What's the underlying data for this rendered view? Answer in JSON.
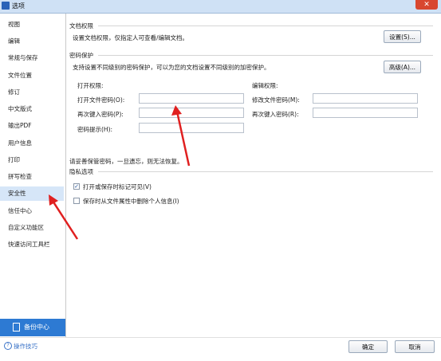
{
  "window": {
    "title": "选项",
    "close_symbol": "✕"
  },
  "sidebar": {
    "items": [
      {
        "label": "视图"
      },
      {
        "label": "编辑"
      },
      {
        "label": "常规与保存"
      },
      {
        "label": "文件位置"
      },
      {
        "label": "修订"
      },
      {
        "label": "中文版式"
      },
      {
        "label": "输出PDF"
      },
      {
        "label": "用户信息"
      },
      {
        "label": "打印"
      },
      {
        "label": "拼写检查"
      },
      {
        "label": "安全性",
        "active": true
      },
      {
        "label": "信任中心"
      },
      {
        "label": "自定义功能区"
      },
      {
        "label": "快速访问工具栏"
      }
    ],
    "backup_label": "备份中心"
  },
  "doc_permission": {
    "title": "文档权限",
    "desc": "设置文档权限，仅指定人可查看/编辑文档。",
    "button": "设置(S)..."
  },
  "password": {
    "title": "密码保护",
    "desc": "支持设置不同级别的密码保护，可以为您的文档设置不同级别的加密保护。",
    "advanced_button": "高级(A)...",
    "open_group": "打开权限:",
    "open_password_label": "打开文件密码(O):",
    "open_confirm_label": "再次键入密码(P):",
    "hint_label": "密码提示(H):",
    "edit_group": "编辑权限:",
    "edit_password_label": "修改文件密码(M):",
    "edit_confirm_label": "再次键入密码(R):",
    "warning": "请妥善保管密码，一旦遗忘，则无法恢复。",
    "open_password_value": "",
    "open_confirm_value": "",
    "hint_value": "",
    "edit_password_value": "",
    "edit_confirm_value": ""
  },
  "privacy": {
    "title": "隐私选项",
    "option1": "打开或保存时标记可见(V)",
    "option1_checked": true,
    "option2": "保存时从文件属性中删除个人信息(I)",
    "option2_checked": false
  },
  "footer": {
    "tips_label": "操作技巧",
    "ok_label": "确定",
    "cancel_label": "取消"
  },
  "colors": {
    "accent": "#2d7ad3",
    "annotation_arrow": "#e02020"
  }
}
